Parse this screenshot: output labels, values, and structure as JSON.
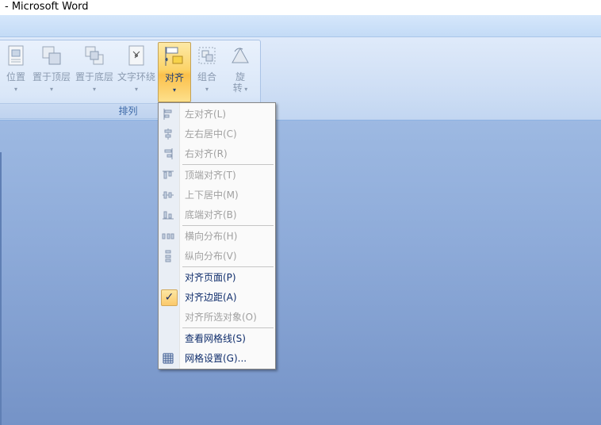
{
  "window": {
    "title": "- Microsoft Word"
  },
  "ribbon": {
    "group_label": "排列",
    "buttons": [
      {
        "label": "位置",
        "icon": "position-icon"
      },
      {
        "label": "置于顶层",
        "icon": "bring-to-front-icon"
      },
      {
        "label": "置于底层",
        "icon": "send-to-back-icon"
      },
      {
        "label": "文字环绕",
        "icon": "text-wrap-icon"
      },
      {
        "label": "对齐",
        "icon": "align-icon",
        "active": true
      },
      {
        "label": "组合",
        "icon": "group-icon"
      },
      {
        "label": "旋",
        "label2": "转",
        "icon": "rotate-icon"
      }
    ]
  },
  "menu": {
    "items": [
      {
        "label": "左对齐(L)",
        "icon": "align-left-icon",
        "enabled": false
      },
      {
        "label": "左右居中(C)",
        "icon": "align-center-icon",
        "enabled": false
      },
      {
        "label": "右对齐(R)",
        "icon": "align-right-icon",
        "enabled": false
      },
      {
        "label": "顶端对齐(T)",
        "icon": "align-top-icon",
        "enabled": false
      },
      {
        "label": "上下居中(M)",
        "icon": "align-middle-icon",
        "enabled": false
      },
      {
        "label": "底端对齐(B)",
        "icon": "align-bottom-icon",
        "enabled": false
      },
      {
        "label": "横向分布(H)",
        "icon": "distribute-horizontal-icon",
        "enabled": false
      },
      {
        "label": "纵向分布(V)",
        "icon": "distribute-vertical-icon",
        "enabled": false
      },
      {
        "label": "对齐页面(P)",
        "icon": "",
        "enabled": true
      },
      {
        "label": "对齐边距(A)",
        "icon": "checkmark-icon",
        "enabled": true,
        "checked": true
      },
      {
        "label": "对齐所选对象(O)",
        "icon": "",
        "enabled": false
      },
      {
        "label": "查看网格线(S)",
        "icon": "",
        "enabled": true
      },
      {
        "label": "网格设置(G)...",
        "icon": "grid-icon",
        "enabled": true
      }
    ]
  },
  "colors": {
    "accent_active": "#fcd46a",
    "menu_text": "#0e2c6b",
    "disabled_text": "#a0a0a0"
  }
}
